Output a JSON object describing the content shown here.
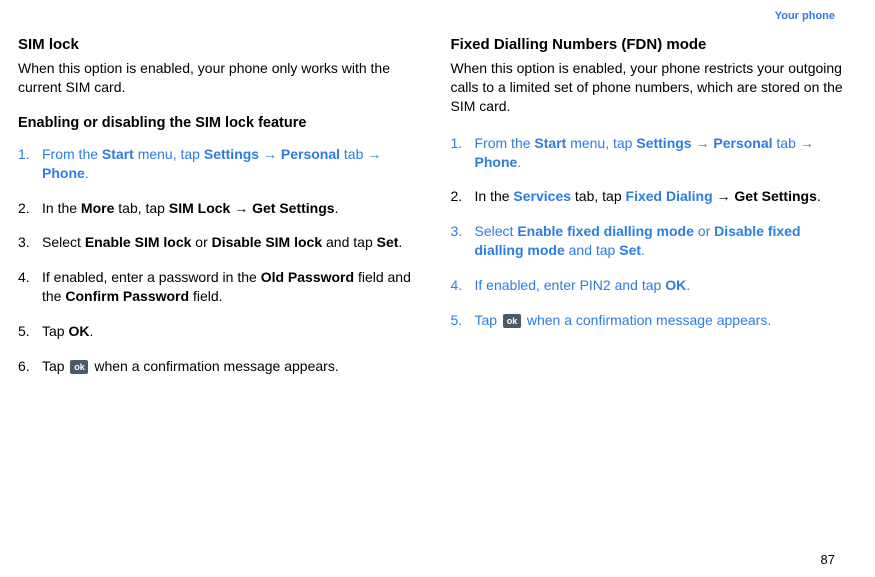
{
  "header": {
    "section": "Your phone"
  },
  "page_number": "87",
  "left": {
    "title": "SIM lock",
    "intro": "When this option is enabled, your phone only works with the current SIM card.",
    "subtitle": "Enabling or disabling the SIM lock feature",
    "steps": [
      {
        "parts": [
          {
            "t": "From the ",
            "b": false
          },
          {
            "t": "Start",
            "b": true
          },
          {
            "t": " menu, tap ",
            "b": false
          },
          {
            "t": "Settings",
            "b": true
          },
          {
            "t": " → ",
            "b": false
          },
          {
            "t": "Personal",
            "b": true
          },
          {
            "t": " tab → ",
            "b": false
          },
          {
            "t": "Phone",
            "b": true
          },
          {
            "t": ".",
            "b": false
          }
        ],
        "blue": true
      },
      {
        "parts": [
          {
            "t": "In the ",
            "b": false
          },
          {
            "t": "More",
            "b": true
          },
          {
            "t": " tab, tap ",
            "b": false
          },
          {
            "t": "SIM Lock",
            "b": true
          },
          {
            "t": " → ",
            "b": false
          },
          {
            "t": "Get Settings",
            "b": true
          },
          {
            "t": ".",
            "b": false
          }
        ],
        "blue": false
      },
      {
        "parts": [
          {
            "t": "Select ",
            "b": false
          },
          {
            "t": "Enable SIM lock",
            "b": true
          },
          {
            "t": " or ",
            "b": false
          },
          {
            "t": "Disable SIM lock",
            "b": true
          },
          {
            "t": " and tap ",
            "b": false
          },
          {
            "t": "Set",
            "b": true
          },
          {
            "t": ".",
            "b": false
          }
        ],
        "blue": false
      },
      {
        "parts": [
          {
            "t": "If enabled, enter a password in the ",
            "b": false
          },
          {
            "t": "Old Password",
            "b": true
          },
          {
            "t": " field and the ",
            "b": false
          },
          {
            "t": "Confirm Password",
            "b": true
          },
          {
            "t": " field.",
            "b": false
          }
        ],
        "blue": false
      },
      {
        "parts": [
          {
            "t": "Tap ",
            "b": false
          },
          {
            "t": "OK",
            "b": true
          },
          {
            "t": ".",
            "b": false
          }
        ],
        "blue": false
      },
      {
        "parts": [
          {
            "t": "Tap ",
            "b": false
          },
          {
            "t": "[OK]",
            "b": false,
            "icon": true
          },
          {
            "t": " when a confirmation message appears.",
            "b": false
          }
        ],
        "blue": false
      }
    ]
  },
  "right": {
    "title": "Fixed Dialling Numbers (FDN) mode",
    "intro": "When this option is enabled, your phone restricts your outgoing calls to a limited set of phone numbers, which are stored on the SIM card.",
    "steps": [
      {
        "parts": [
          {
            "t": "From the ",
            "b": false
          },
          {
            "t": "Start",
            "b": true
          },
          {
            "t": " menu, tap ",
            "b": false
          },
          {
            "t": "Settings",
            "b": true
          },
          {
            "t": " → ",
            "b": false
          },
          {
            "t": "Personal",
            "b": true
          },
          {
            "t": " tab → ",
            "b": false
          },
          {
            "t": "Phone",
            "b": true
          },
          {
            "t": ".",
            "b": false
          }
        ],
        "blue": true
      },
      {
        "parts": [
          {
            "t": "In the ",
            "b": false
          },
          {
            "t": "Services",
            "b": true,
            "blue": true
          },
          {
            "t": " tab, tap ",
            "b": false
          },
          {
            "t": "Fixed Dialing",
            "b": true,
            "blue": true
          },
          {
            "t": " → ",
            "b": false
          },
          {
            "t": "Get Settings",
            "b": true
          },
          {
            "t": ".",
            "b": false
          }
        ],
        "blue": false
      },
      {
        "parts": [
          {
            "t": "Select ",
            "b": false
          },
          {
            "t": "Enable fixed dialling mode",
            "b": true
          },
          {
            "t": " or ",
            "b": false
          },
          {
            "t": "Disable fixed dialling mode",
            "b": true
          },
          {
            "t": " and tap ",
            "b": false
          },
          {
            "t": "Set",
            "b": true
          },
          {
            "t": ".",
            "b": false
          }
        ],
        "blue": true
      },
      {
        "parts": [
          {
            "t": "If enabled, enter PIN2 and tap ",
            "b": false
          },
          {
            "t": "OK",
            "b": true
          },
          {
            "t": ".",
            "b": false
          }
        ],
        "blue": true
      },
      {
        "parts": [
          {
            "t": "Tap ",
            "b": false
          },
          {
            "t": "[OK]",
            "b": false,
            "icon": true
          },
          {
            "t": " when a confirmation message appears.",
            "b": false
          }
        ],
        "blue": true
      }
    ]
  }
}
